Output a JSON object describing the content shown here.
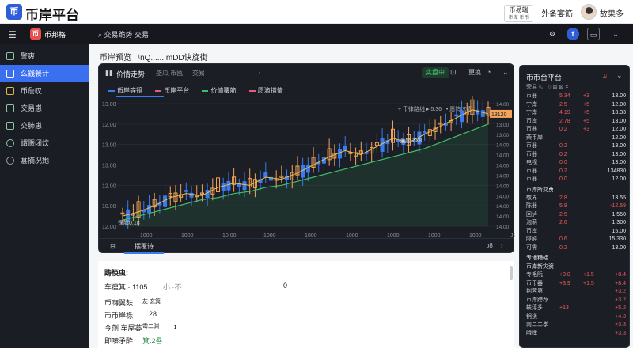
{
  "topbar": {
    "brand": "币岸平台",
    "logo_glyph": "币",
    "badge_line1": "币易端",
    "badge_line2": "币库 币币",
    "link": "外备宴筋",
    "user": "故果多"
  },
  "app_header": {
    "menu_icon": "hamburger-icon",
    "app_name": "币邦格",
    "search_text": "交易跪势  交易",
    "right_icons": [
      "settings-icon",
      "facebook-icon",
      "app-icon",
      "chevron-down-icon"
    ]
  },
  "sidebar": {
    "items": [
      {
        "label": "警爽",
        "icon": "grid-icon",
        "active": false
      },
      {
        "label": "么銭餐计",
        "icon": "calc-icon",
        "active": true
      },
      {
        "label": "币詹叹",
        "icon": "wallet-icon",
        "active": false
      },
      {
        "label": "交易崽",
        "icon": "chat-icon",
        "active": false
      },
      {
        "label": "交肺崽",
        "icon": "chat-icon",
        "active": false
      },
      {
        "label": "謂赈闭炊",
        "icon": "globe-icon",
        "active": false
      },
      {
        "label": "葚摘况她",
        "icon": "gear-icon",
        "active": false
      }
    ]
  },
  "main": {
    "title": "币岸预览 · ᵗnQ.......mDD诀旋街"
  },
  "chart_card": {
    "title": "价情走势",
    "tabs": [
      "盛瓜 币瓯",
      "交易"
    ],
    "btn_live": "实盘中",
    "btn_more": "更换",
    "legend": [
      {
        "label": "币岸等镜",
        "color": "#3a7bf0"
      },
      {
        "label": "币岸平台",
        "color": "#e85b7a"
      },
      {
        "label": "价情覆筋",
        "color": "#3fbf6a"
      },
      {
        "label": "愿滴描情",
        "color": "#e85b7a"
      }
    ],
    "legend_right": [
      "+ 币律路线 ▸ 5.36",
      "• 愿钨炫情 ᵗ"
    ],
    "current_price": "13120",
    "annotation": "强度 7X8",
    "bottom_label": "保脂0.18",
    "footer_tab": "摆覆诗",
    "footer_right": "ᴊ8"
  },
  "chart_data": {
    "type": "line",
    "series": [
      {
        "name": "币岸等镜",
        "values": [
          12.0,
          12.2,
          12.5,
          12.9,
          13.1,
          13.0,
          13.4,
          13.6,
          13.5,
          13.9,
          13.8,
          14.1,
          14.5,
          14.9,
          15.2,
          15.0,
          15.4,
          15.8,
          15.6,
          16.0,
          16.4,
          16.8,
          17.2,
          17.0
        ]
      },
      {
        "name": "价情覆筋",
        "values": [
          11.8,
          12.0,
          12.2,
          12.4,
          12.6,
          12.8,
          12.9,
          13.1,
          13.2,
          13.4,
          13.5,
          13.7,
          13.9,
          14.1,
          14.3,
          14.5,
          14.7,
          14.9,
          15.1,
          15.3,
          15.6,
          15.9,
          16.2,
          16.5
        ]
      }
    ],
    "yticks": [
      "13.00",
      "12.00",
      "13.00",
      "13.00",
      "12.00",
      "10.00",
      "12.00"
    ],
    "yticks_right": [
      "14.00",
      "13.00",
      "13.00",
      "13.00",
      "14.00",
      "14.00",
      "14.00",
      "14.00",
      "14.00",
      "14.00",
      "14.00",
      "14.00",
      "14.00"
    ],
    "xticks": [
      "1000",
      "1000",
      "10.00",
      "1000",
      "1000",
      "1000",
      "1000",
      "1000",
      "1000",
      "J8"
    ],
    "grid": true
  },
  "info_list": {
    "header": "踌筷虫:",
    "rows": [
      {
        "label": "车瘦箕 · 1105",
        "mid": "小 ·不",
        "val": "0"
      },
      {
        "label": "币嗨翼麸",
        "mid": "",
        "val": "友 玄箕"
      },
      {
        "label": "币币岸栎",
        "mid": "",
        "val": "28"
      },
      {
        "label": "今剂 车屋蒌",
        "mid": "",
        "val": "霉二渊"
      },
      {
        "label": "即嗪矛酔",
        "mid": "",
        "val": "箕.2晷"
      }
    ]
  },
  "right_panel": {
    "title": "币币台平台",
    "subtitle": "荣易 ᵃ。 ○ ⊠ ⊠ ×",
    "header": [
      "合斛",
      "朵",
      "·",
      "13.00"
    ],
    "rows": [
      {
        "a": "币器",
        "b": "5.34",
        "c": "+3",
        "d": "13.00"
      },
      {
        "a": "宁岸",
        "b": "2.5",
        "c": "+5",
        "d": "12.00"
      },
      {
        "a": "宁岸",
        "b": "4.19",
        "c": "+5",
        "d": "13.33"
      },
      {
        "a": "币岸",
        "b": "2.78",
        "c": "+5",
        "d": "13.00"
      },
      {
        "a": "币器",
        "b": "0.2",
        "c": "+3",
        "d": "12.00"
      },
      {
        "a": "荣币岸",
        "b": "",
        "c": "",
        "d": "12.00"
      },
      {
        "a": "币器",
        "b": "0.2",
        "c": "",
        "d": "13.00"
      },
      {
        "a": "币器",
        "b": "0.2",
        "c": "",
        "d": "13.00"
      },
      {
        "a": "电视",
        "b": "0.0",
        "c": "",
        "d": "13.00"
      },
      {
        "a": "币器",
        "b": "0.2",
        "c": "",
        "d": "134830"
      },
      {
        "a": "币器",
        "b": "0.0",
        "c": "",
        "d": "12.00"
      }
    ],
    "section2": "币岸所交勇",
    "rows2": [
      {
        "a": "敬界",
        "b": "2.8",
        "c": "",
        "d": "13.55"
      },
      {
        "a": "陈器",
        "b": "5.8",
        "c": "",
        "d": "-12.59"
      },
      {
        "a": "回泸",
        "b": "2.5",
        "c": "",
        "d": "1.550"
      },
      {
        "a": "泡萌",
        "b": "2.6",
        "c": "",
        "d": "1.300"
      },
      {
        "a": "币岸",
        "b": "",
        "c": "",
        "d": "15.00"
      },
      {
        "a": "障醉",
        "b": "0.6",
        "c": "",
        "d": "15.330"
      },
      {
        "a": "可需",
        "b": "0.2",
        "c": "",
        "d": "13.00"
      }
    ],
    "section3": "专地糟硅",
    "section4": "币岸新灾资",
    "rows3": [
      {
        "a": "专毛阮",
        "b": "+3.0",
        "c": "+1.5",
        "d": "+8.4"
      },
      {
        "a": "币币器",
        "b": "+3.9",
        "c": "+1.5",
        "d": "+8.4"
      },
      {
        "a": "荆蓉第",
        "b": "",
        "c": "",
        "d": "+3.2"
      },
      {
        "a": "币岸跨荐",
        "b": "",
        "c": "",
        "d": "+3.2"
      },
      {
        "a": "轶淳多",
        "b": "+13",
        "c": "",
        "d": "+5.2"
      },
      {
        "a": "钥浇",
        "b": "",
        "c": "",
        "d": "+4.3"
      },
      {
        "a": "南二二孝",
        "b": "",
        "c": "",
        "d": "+3.3"
      },
      {
        "a": "哦嘿",
        "b": "",
        "c": "",
        "d": "+3.3"
      }
    ]
  }
}
